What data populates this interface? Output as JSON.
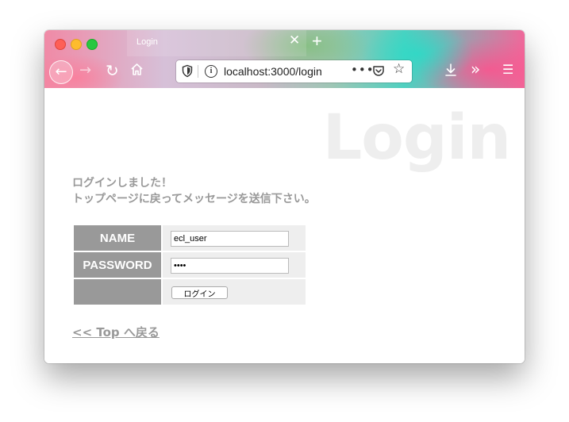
{
  "browser": {
    "tab_title": "Login",
    "tab_close": "✕",
    "new_tab": "+",
    "url": "localhost:3000/login",
    "page_actions": "•••",
    "star": "☆",
    "back": "←",
    "forward": "→",
    "reload": "↻",
    "overflow": "»",
    "menu": "☰"
  },
  "page": {
    "watermark": "Login",
    "message_line1": "ログインしました！",
    "message_line2": "トップページに戻ってメッセージを送信下さい。",
    "form": {
      "name_label": "NAME",
      "name_value": "ecl_user",
      "password_label": "PASSWORD",
      "password_value": "••••",
      "submit_label": "ログイン"
    },
    "top_link": "<< Top へ戻る"
  }
}
